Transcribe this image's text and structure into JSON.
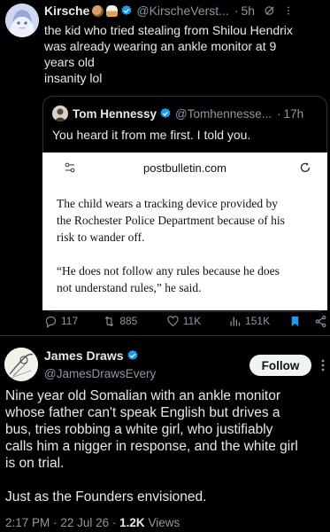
{
  "tweet1": {
    "author_name": "Kirsche",
    "emojis": [
      "cookie-emoji",
      "cupcake-emoji"
    ],
    "handle": "@KirscheVerst...",
    "separator": "·",
    "time": "5h",
    "text_lines": [
      "the kid who tried stealing from Shilou Hendrix",
      "was already wearing an ankle monitor at 9",
      "years old",
      "insanity lol"
    ],
    "quote": {
      "author_name": "Tom Hennessy",
      "handle": "@Tomhennesse...",
      "separator": "·",
      "time": "17h",
      "text": "You heard it from me first. I told you.",
      "article": {
        "url": "postbulletin.com",
        "paragraph1_lines": [
          "The child wears a tracking device provided by",
          "the Rochester Police Department because of his",
          "risk to wander off."
        ],
        "paragraph2_lines": [
          "“He does not follow any rules because he does",
          "not understand rules,” he said."
        ]
      }
    },
    "actions": {
      "replies": "117",
      "reposts": "885",
      "likes": "11K",
      "views": "151K"
    }
  },
  "tweet2": {
    "author_name": "James Draws",
    "handle": "@JamesDrawsEvery",
    "follow_label": "Follow",
    "text_lines": [
      "Nine year old Somalian with an ankle monitor",
      "whose father can't speak English but drives a",
      "bus, tries robbing a white girl, who justifiably",
      "calls him a nigger in response, and the white girl",
      "is on trial."
    ],
    "text_line2": "Just as the Founders envisioned.",
    "time": "2:17 PM",
    "separator": "·",
    "date": "22 Jul 26",
    "views_count": "1.2K",
    "views_label": "Views"
  },
  "colors": {
    "background": "#000000",
    "text": "#e7e9ea",
    "muted": "#8b98a5",
    "verified": "#1d9bf0",
    "bookmark": "#1d9bf0",
    "divider": "#2f3336"
  }
}
